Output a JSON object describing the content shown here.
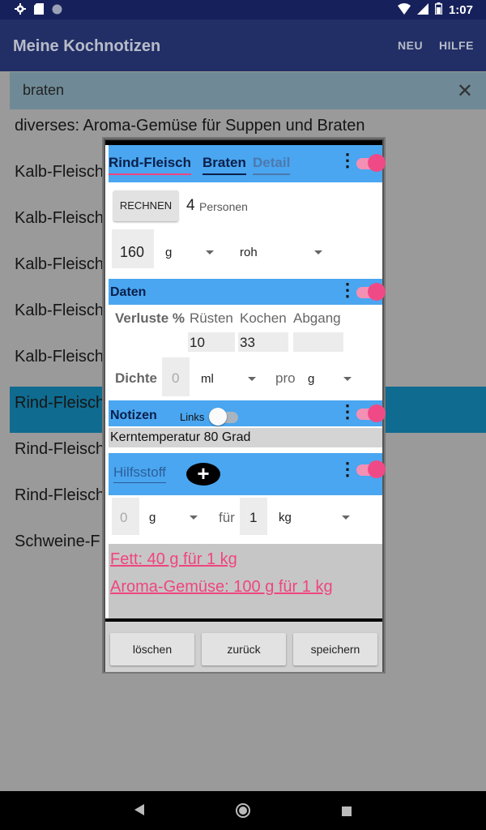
{
  "status_bar": {
    "time": "1:07",
    "icons_left": [
      "gear-icon",
      "sd-card-icon",
      "circle-icon"
    ],
    "icons_right": [
      "wifi-icon",
      "signal-icon",
      "battery-icon"
    ]
  },
  "app_bar": {
    "title": "Meine Kochnotizen",
    "actions": [
      "NEU",
      "HILFE"
    ]
  },
  "search": {
    "query": "braten"
  },
  "list": {
    "items": [
      "diverses: Aroma-Gemüse für Suppen und Braten",
      "Kalb-Fleisch",
      "Kalb-Fleisch",
      "Kalb-Fleisch",
      "Kalb-Fleisch",
      "Kalb-Fleisch",
      "Rind-Fleisch",
      "Rind-Fleisch",
      "Rind-Fleisch",
      "Schweine-F"
    ],
    "selected_index": 6
  },
  "dialog": {
    "tabs": [
      "Rind-Fleisch",
      "Braten",
      "Detail"
    ],
    "calc_button": "RECHNEN",
    "persons_count": "4",
    "persons_label": "Personen",
    "amount": "160",
    "amount_unit": "g",
    "state": "roh",
    "daten": {
      "title": "Daten",
      "verluste_label": "Verluste %",
      "col_ruesten": "Rüsten",
      "col_kochen": "Kochen",
      "col_abgang": "Abgang",
      "val_ruesten": "10",
      "val_kochen": "33",
      "val_abgang": "",
      "dichte_label": "Dichte",
      "dichte_value": "0",
      "dichte_unit": "ml",
      "pro_label": "pro",
      "pro_unit": "g"
    },
    "notizen": {
      "title": "Notizen",
      "links_label": "Links",
      "note_text": "Kerntemperatur 80 Grad"
    },
    "hilfsstoff": {
      "title": "Hilfsstoff",
      "qty": "0",
      "qty_unit": "g",
      "fuer_label": "für",
      "per_qty": "1",
      "per_unit": "kg",
      "entries": [
        "Fett: 40 g für 1 kg",
        "Aroma-Gemüse: 100 g für 1 kg"
      ]
    },
    "buttons": {
      "delete": "löschen",
      "back": "zurück",
      "save": "speichern"
    }
  },
  "colors": {
    "accent_blue": "#4aa6f0",
    "accent_pink": "#f0457f",
    "app_bar": "#222f66"
  }
}
